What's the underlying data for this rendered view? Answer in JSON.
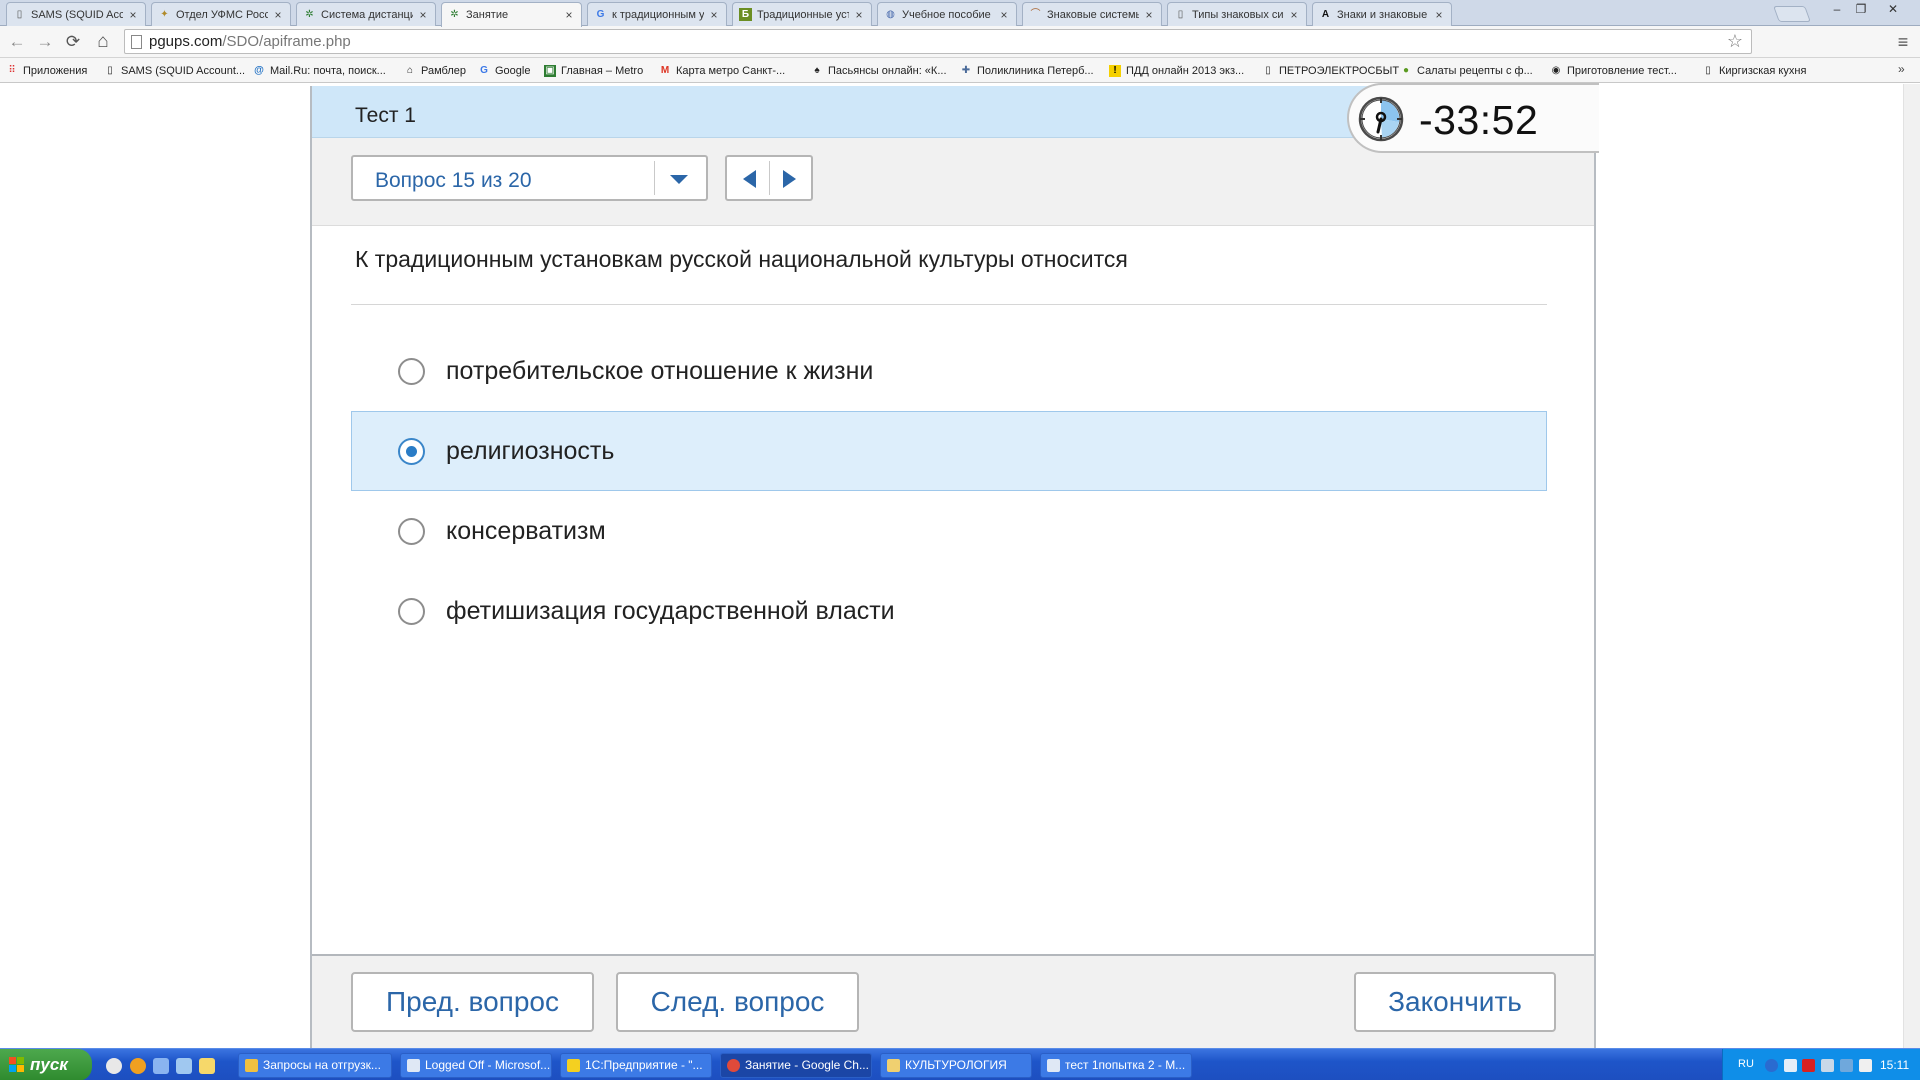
{
  "browser": {
    "tabs": [
      {
        "label": "SAMS (SQUID Account M",
        "icon": "page-icon"
      },
      {
        "label": "Отдел УФМС России по",
        "icon": "emblem-icon"
      },
      {
        "label": "Система дистанционног",
        "icon": "pgups-icon"
      },
      {
        "label": "Занятие",
        "icon": "pgups-icon",
        "active": true
      },
      {
        "label": "к традиционным устано",
        "icon": "google-icon"
      },
      {
        "label": "Традиционные установ",
        "icon": "b-icon"
      },
      {
        "label": "Учебное пособие",
        "icon": "globe-icon"
      },
      {
        "label": "Знаковые системы запи",
        "icon": "site-icon"
      },
      {
        "label": "Типы знаковых систем и",
        "icon": "page-icon"
      },
      {
        "label": "Знаки и знаковые систе",
        "icon": "a-icon"
      }
    ],
    "tab_close": "×",
    "window_controls": {
      "minimize": "–",
      "maximize": "❐",
      "close": "✕"
    },
    "nav": {
      "back": "←",
      "forward": "→",
      "reload": "⟳",
      "home": "⌂"
    },
    "url": {
      "host": "pgups.com",
      "path": "/SDO/apiframe.php"
    },
    "star": "☆",
    "menu": "≡",
    "bookmarks": [
      {
        "label": "Приложения",
        "icon": "apps-icon"
      },
      {
        "label": "SAMS (SQUID Account...",
        "icon": "page-icon"
      },
      {
        "label": "Mail.Ru: почта, поиск...",
        "icon": "mailru-icon"
      },
      {
        "label": "Рамблер",
        "icon": "rambler-icon"
      },
      {
        "label": "Google",
        "icon": "google-icon"
      },
      {
        "label": "Главная – Metro",
        "icon": "metro-icon"
      },
      {
        "label": "Карта метро Санкт-...",
        "icon": "metro-m-icon"
      },
      {
        "label": "Пасьянсы онлайн: «К...",
        "icon": "spade-icon"
      },
      {
        "label": "Поликлиника Петерб...",
        "icon": "clinic-icon"
      },
      {
        "label": "ПДД онлайн 2013 экз...",
        "icon": "warning-icon"
      },
      {
        "label": "ПЕТРОЭЛЕКТРОСБЫТ",
        "icon": "page-icon"
      },
      {
        "label": "Салаты рецепты с ф...",
        "icon": "salad-icon"
      },
      {
        "label": "Приготовление тест...",
        "icon": "chef-icon"
      },
      {
        "label": "Киргизская кухня",
        "icon": "page-icon"
      }
    ],
    "bookmarks_more": "»"
  },
  "quiz": {
    "title": "Тест 1",
    "question_selector": "Вопрос 15 из 20",
    "timer": "-33:52",
    "question": "К традиционным установкам русской национальной культуры относится",
    "answers": [
      {
        "text": "потребительское отношение к жизни",
        "selected": false
      },
      {
        "text": "религиозность",
        "selected": true
      },
      {
        "text": "консерватизм",
        "selected": false
      },
      {
        "text": "фетишизация государственной власти",
        "selected": false
      }
    ],
    "buttons": {
      "prev": "Пред. вопрос",
      "next": "След. вопрос",
      "finish": "Закончить"
    }
  },
  "taskbar": {
    "start": "пуск",
    "tasks": [
      {
        "label": "Запросы на отгрузк...",
        "active": false
      },
      {
        "label": "Logged Off - Microsof...",
        "active": false
      },
      {
        "label": "1С:Предприятие - \"...",
        "active": false
      },
      {
        "label": "Занятие - Google Ch...",
        "active": true
      },
      {
        "label": "КУЛЬТУРОЛОГИЯ",
        "active": false
      },
      {
        "label": "тест 1попытка 2 - M...",
        "active": false
      }
    ],
    "lang": "RU",
    "clock": "15:11"
  },
  "colors": {
    "accent": "#2b66a8",
    "header": "#cfe7f9",
    "selected": "#ddeefb"
  }
}
